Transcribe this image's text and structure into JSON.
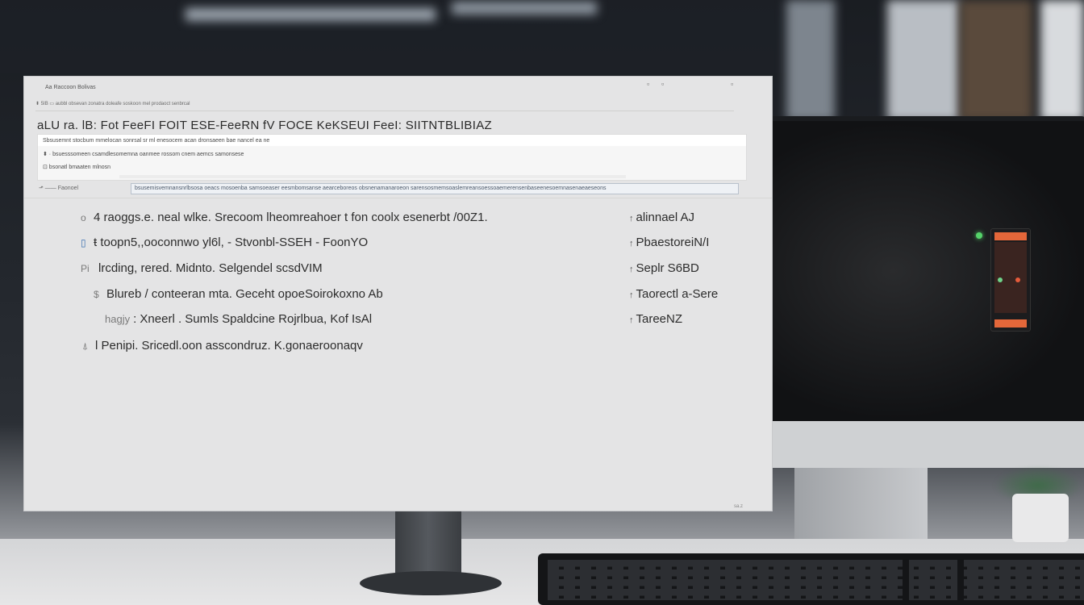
{
  "window": {
    "title": "Aa Raccoon Bolivas",
    "address": "⬍ 5IB ▭  aubbl obsevan  zonatra  doleafe  soskoon  mel  prodaoct  senbrcal",
    "heading": "aLU ra. lB: Fot FeeFI FOIT ESE-FeeRN fV FOCE KeKSEUI FeeI: SIITNTBLIBIAZ"
  },
  "list_box": {
    "lines": [
      "Sbsusemnt stocbum mmelocan sonrsal sr ml enesocem acan  dronsaeen bae nancel ea ne",
      "⬍  ·   bsuesssomeen csamdlesomemna oanmee rossom cnem aemcs samonsese",
      "⊡  bsonatl bmaaten mlnosn"
    ]
  },
  "filterbar": {
    "label": "⬏ ——  Faonoel",
    "value": "bsusemisvemnansnrlbsosa oeacs mosoenba samsoeaser eesmbomsanse aearceboreos obsnenamanaroeon sarensosmemsoaslemreansoessoaemerensenbaseenesoemnasenaeaeseons"
  },
  "rows": [
    {
      "icon": "o",
      "text": "4 raoggs.e.  neal wlke. Srecoom lheomreahoer  t fon  coolx esenerbt /00Z1.",
      "right": "alinnael AJ"
    },
    {
      "icon": "▯",
      "text": "ŧ toopn5,,ooconnwo yl6l, - Stvonbl-SSEH  -  FoonYO",
      "right": "Pbaestorei​N/I"
    },
    {
      "icon": "Pi",
      "text": "lrcding,  rered. Midnto. Selgendel scsdVIM",
      "right": "Seplr S6BD"
    },
    {
      "icon": "$",
      "text": "Blureb / conteeran mta. Geceht  opoeSoirokoxno Ab",
      "right": "Taorectl a-Sere"
    },
    {
      "icon": "hagjy",
      "text": ":  Xneerl .  Sumls  Spaldcine Rojrlbua, Kof IsAl",
      "right": "TareeNZ"
    },
    {
      "icon": "⍋",
      "text": "l  Penipi. Sricedl.oon   asscondruz. K.gonaeroonaqv",
      "right": ""
    }
  ],
  "footer": "sa.z"
}
